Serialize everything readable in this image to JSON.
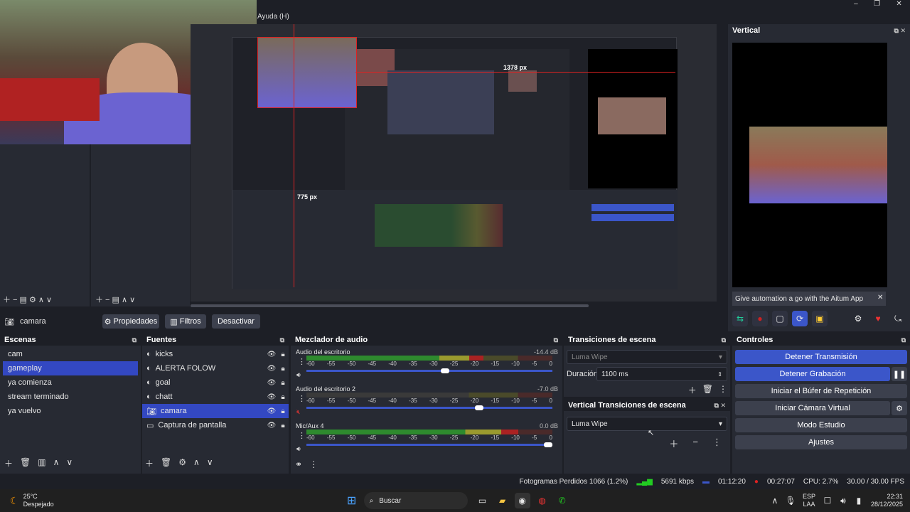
{
  "menu": {
    "help": "Ayuda (H)"
  },
  "preview": {
    "dim_label_h": "1378 px",
    "dim_label_v": "775 px",
    "nested_menu": "Ayuda (H)"
  },
  "vertical": {
    "title": "Vertical",
    "banner": "Give automation a go with the Aitum App"
  },
  "source_bar": {
    "source_name": "camara",
    "properties": "Propiedades",
    "filters": "Filtros",
    "deactivate": "Desactivar"
  },
  "scenes": {
    "title": "Escenas",
    "items": [
      "cam",
      "gameplay",
      "ya comienza",
      "stream terminado",
      "ya vuelvo"
    ],
    "selected": 1
  },
  "sources": {
    "title": "Fuentes",
    "items": [
      {
        "name": "kicks",
        "icon": "browser-icon"
      },
      {
        "name": "ALERTA FOLOW",
        "icon": "browser-icon"
      },
      {
        "name": "goal",
        "icon": "browser-icon"
      },
      {
        "name": "chatt",
        "icon": "browser-icon"
      },
      {
        "name": "camara",
        "icon": "camera-icon"
      },
      {
        "name": "Captura de pantalla",
        "icon": "monitor-icon"
      }
    ],
    "selected": 4
  },
  "mixer": {
    "title": "Mezclador de audio",
    "tracks": [
      {
        "name": "Audio del escritorio",
        "db": "-14.4 dB",
        "level": 0.72,
        "volume": 0.58
      },
      {
        "name": "Audio del escritorio 2",
        "db": "-7.0 dB",
        "level": 0.0,
        "volume": 0.72
      },
      {
        "name": "Mic/Aux 4",
        "db": "0.0 dB",
        "level": 0.86,
        "volume": 1.0
      }
    ],
    "ticks": [
      "-60",
      "-55",
      "-50",
      "-45",
      "-40",
      "-35",
      "-30",
      "-25",
      "-20",
      "-15",
      "-10",
      "-5",
      "0"
    ]
  },
  "transitions": {
    "title": "Transiciones de escena",
    "transition": "Luma Wipe",
    "duration_label": "Duración",
    "duration_value": "1100 ms"
  },
  "vertical_transitions": {
    "title": "Vertical Transiciones de escena",
    "transition": "Luma Wipe"
  },
  "controls": {
    "title": "Controles",
    "stop_stream": "Detener Transmisión",
    "stop_record": "Detener Grabación",
    "replay_buffer": "Iniciar el Búfer de Repetición",
    "virtual_cam": "Iniciar Cámara Virtual",
    "studio_mode": "Modo Estudio",
    "settings": "Ajustes"
  },
  "status": {
    "dropped_frames": "Fotogramas Perdidos 1066 (1.2%)",
    "bitrate": "5691 kbps",
    "stream_time": "01:12:20",
    "record_time": "00:27:07",
    "cpu": "CPU: 2.7%",
    "fps": "30.00 / 30.00 FPS"
  },
  "taskbar": {
    "temp": "25°C",
    "weather": "Despejado",
    "search": "Buscar",
    "lang1": "ESP",
    "lang2": "LAA",
    "time": "22:31",
    "date": "28/12/2025"
  },
  "colors": {
    "accent": "#3b56c9",
    "panel": "#272a33",
    "bg": "#1d1f26"
  }
}
